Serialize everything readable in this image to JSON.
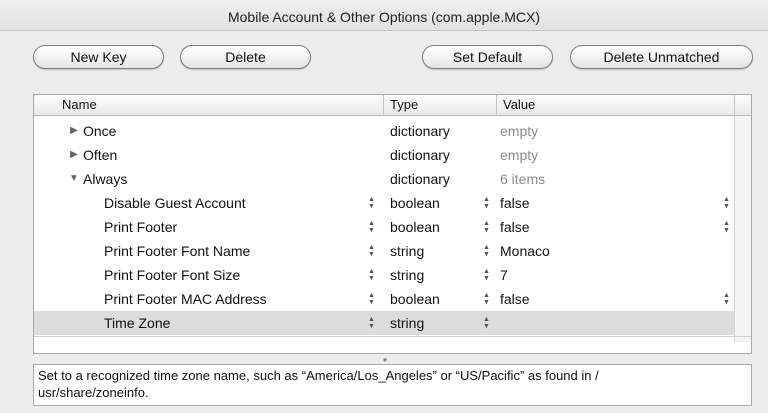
{
  "window": {
    "title": "Mobile Account & Other Options (com.apple.MCX)"
  },
  "toolbar": {
    "new_key": "New Key",
    "delete": "Delete",
    "set_default": "Set Default",
    "delete_unmatched": "Delete Unmatched"
  },
  "table": {
    "columns": {
      "name": "Name",
      "type": "Type",
      "value": "Value"
    },
    "rows": [
      {
        "name": "Once",
        "type": "dictionary",
        "value": "empty"
      },
      {
        "name": "Often",
        "type": "dictionary",
        "value": "empty"
      },
      {
        "name": "Always",
        "type": "dictionary",
        "value": "6 items"
      },
      {
        "name": "Disable Guest Account",
        "type": "boolean",
        "value": "false"
      },
      {
        "name": "Print Footer",
        "type": "boolean",
        "value": "false"
      },
      {
        "name": "Print Footer Font Name",
        "type": "string",
        "value": "Monaco"
      },
      {
        "name": "Print Footer Font Size",
        "type": "string",
        "value": "7"
      },
      {
        "name": "Print Footer MAC Address",
        "type": "boolean",
        "value": "false"
      },
      {
        "name": "Time Zone",
        "type": "string",
        "value": ""
      }
    ]
  },
  "description": {
    "line1": "Set to a recognized time zone name, such as “America/Los_Angeles” or “US/Pacific” as found in /",
    "line2": "usr/share/zoneinfo."
  },
  "icons": {
    "collapsed": "disclosure-triangle-right",
    "expanded": "disclosure-triangle-down",
    "stepper": "up-down-stepper"
  }
}
